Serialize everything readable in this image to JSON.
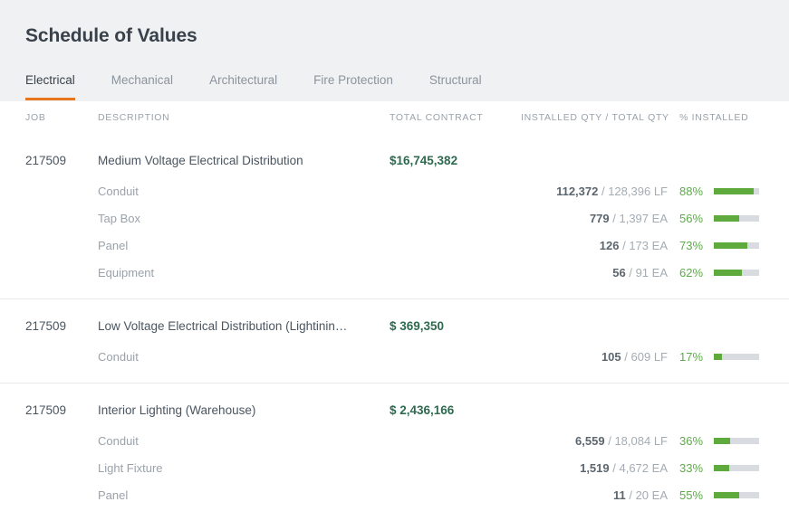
{
  "header": {
    "title": "Schedule of Values",
    "tabs": [
      {
        "label": "Electrical",
        "active": true
      },
      {
        "label": "Mechanical",
        "active": false
      },
      {
        "label": "Architectural",
        "active": false
      },
      {
        "label": "Fire Protection",
        "active": false
      },
      {
        "label": "Structural",
        "active": false
      }
    ]
  },
  "accent_color": "#e8761c",
  "progress_color": "#5faa3c",
  "progress_track_color": "#d8dbdf",
  "money_color": "#2e6a50",
  "columns": {
    "job": "JOB",
    "description": "DESCRIPTION",
    "total_contract": "TOTAL CONTRACT",
    "installed_total_qty": "INSTALLED QTY / TOTAL QTY",
    "percent_installed": "% INSTALLED"
  },
  "groups": [
    {
      "job": "217509",
      "description": "Medium Voltage Electrical Distribution",
      "total_contract": "$16,745,382",
      "items": [
        {
          "description": "Conduit",
          "installed": "112,372",
          "separator": "/",
          "total": "128,396",
          "unit": "LF",
          "percent": "88%",
          "percent_value": 88
        },
        {
          "description": "Tap Box",
          "installed": "779",
          "separator": "/",
          "total": "1,397",
          "unit": "EA",
          "percent": "56%",
          "percent_value": 56
        },
        {
          "description": "Panel",
          "installed": "126",
          "separator": "/",
          "total": "173",
          "unit": "EA",
          "percent": "73%",
          "percent_value": 73
        },
        {
          "description": "Equipment",
          "installed": "56",
          "separator": "/",
          "total": "91",
          "unit": "EA",
          "percent": "62%",
          "percent_value": 62
        }
      ]
    },
    {
      "job": "217509",
      "description": "Low Voltage Electrical Distribution (Lightinin…",
      "total_contract": "$ 369,350",
      "items": [
        {
          "description": "Conduit",
          "installed": "105",
          "separator": "/",
          "total": "609",
          "unit": "LF",
          "percent": "17%",
          "percent_value": 17
        }
      ]
    },
    {
      "job": "217509",
      "description": "Interior Lighting (Warehouse)",
      "total_contract": "$ 2,436,166",
      "items": [
        {
          "description": "Conduit",
          "installed": "6,559",
          "separator": "/",
          "total": "18,084",
          "unit": "LF",
          "percent": "36%",
          "percent_value": 36
        },
        {
          "description": "Light Fixture",
          "installed": "1,519",
          "separator": "/",
          "total": "4,672",
          "unit": "EA",
          "percent": "33%",
          "percent_value": 33
        },
        {
          "description": "Panel",
          "installed": "11",
          "separator": "/",
          "total": "20",
          "unit": "EA",
          "percent": "55%",
          "percent_value": 55
        }
      ]
    }
  ]
}
